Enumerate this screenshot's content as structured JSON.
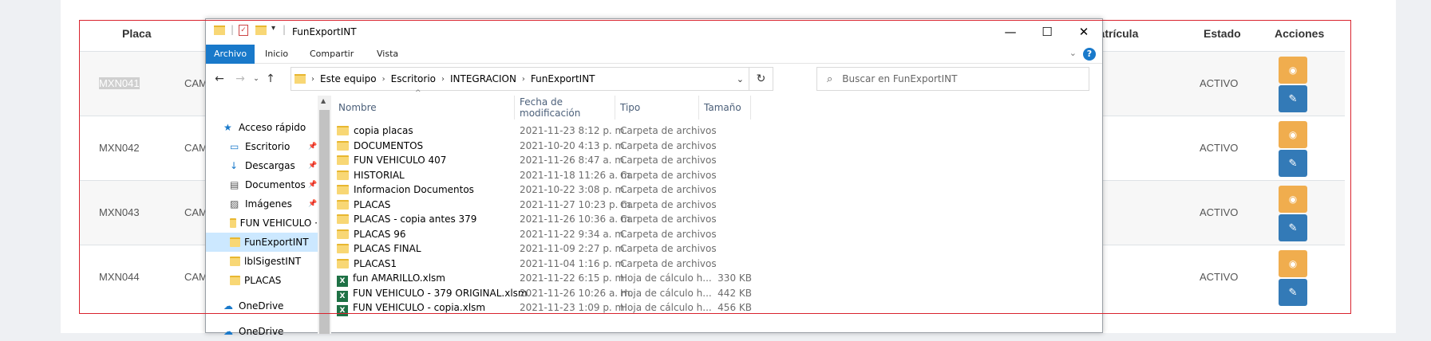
{
  "background_table": {
    "headers": {
      "placa": "Placa",
      "matricula": "natrícula",
      "estado": "Estado",
      "acciones": "Acciones"
    },
    "rows": [
      {
        "placa": "MXN041",
        "tipo": "CAM",
        "estado": "ACTIVO"
      },
      {
        "placa": "MXN042",
        "tipo": "CAM",
        "estado": "ACTIVO"
      },
      {
        "placa": "MXN043",
        "tipo": "CAM",
        "estado": "ACTIVO"
      },
      {
        "placa": "MXN044",
        "tipo": "CAM",
        "estado": "ACTIVO"
      }
    ],
    "colors": {
      "view_button": "#f0ad4e",
      "edit_button": "#337ab7",
      "highlight_box": "#d9232e"
    }
  },
  "explorer": {
    "title": "FunExportINT",
    "ribbon_tabs": [
      "Archivo",
      "Inicio",
      "Compartir",
      "Vista"
    ],
    "breadcrumb": [
      "Este equipo",
      "Escritorio",
      "INTEGRACION",
      "FunExportINT"
    ],
    "search_placeholder": "Buscar en FunExportINT",
    "nav_pane": [
      {
        "label": "Acceso rápido",
        "icon": "star-icon"
      },
      {
        "label": "Escritorio",
        "icon": "desktop-icon",
        "pinned": true
      },
      {
        "label": "Descargas",
        "icon": "download-icon",
        "pinned": true
      },
      {
        "label": "Documentos",
        "icon": "document-icon",
        "pinned": true
      },
      {
        "label": "Imágenes",
        "icon": "image-icon",
        "pinned": true
      },
      {
        "label": "FUN VEHICULO ·",
        "icon": "folder-icon"
      },
      {
        "label": "FunExportINT",
        "icon": "folder-icon",
        "selected": true
      },
      {
        "label": "lblSigestINT",
        "icon": "folder-icon"
      },
      {
        "label": "PLACAS",
        "icon": "folder-icon"
      },
      {
        "label": "OneDrive",
        "icon": "cloud-icon"
      },
      {
        "label": "OneDrive",
        "icon": "cloud-icon"
      }
    ],
    "columns": [
      "Nombre",
      "Fecha de modificación",
      "Tipo",
      "Tamaño"
    ],
    "files": [
      {
        "name": "copia placas",
        "date": "2021-11-23 8:12 p. m.",
        "type": "Carpeta de archivos",
        "size": "",
        "icon": "folder"
      },
      {
        "name": "DOCUMENTOS",
        "date": "2021-10-20 4:13 p. m.",
        "type": "Carpeta de archivos",
        "size": "",
        "icon": "folder"
      },
      {
        "name": "FUN VEHICULO 407",
        "date": "2021-11-26 8:47 a. m.",
        "type": "Carpeta de archivos",
        "size": "",
        "icon": "folder"
      },
      {
        "name": "HISTORIAL",
        "date": "2021-11-18 11:26 a. m.",
        "type": "Carpeta de archivos",
        "size": "",
        "icon": "folder"
      },
      {
        "name": "Informacion Documentos",
        "date": "2021-10-22 3:08 p. m.",
        "type": "Carpeta de archivos",
        "size": "",
        "icon": "folder"
      },
      {
        "name": "PLACAS",
        "date": "2021-11-27 10:23 p. m.",
        "type": "Carpeta de archivos",
        "size": "",
        "icon": "folder"
      },
      {
        "name": "PLACAS - copia antes 379",
        "date": "2021-11-26 10:36 a. m.",
        "type": "Carpeta de archivos",
        "size": "",
        "icon": "folder"
      },
      {
        "name": "PLACAS 96",
        "date": "2021-11-22 9:34 a. m.",
        "type": "Carpeta de archivos",
        "size": "",
        "icon": "folder"
      },
      {
        "name": "PLACAS FINAL",
        "date": "2021-11-09 2:27 p. m.",
        "type": "Carpeta de archivos",
        "size": "",
        "icon": "folder"
      },
      {
        "name": "PLACAS1",
        "date": "2021-11-04 1:16 p. m.",
        "type": "Carpeta de archivos",
        "size": "",
        "icon": "folder"
      },
      {
        "name": "fun AMARILLO.xlsm",
        "date": "2021-11-22 6:15 p. m.",
        "type": "Hoja de cálculo h...",
        "size": "330 KB",
        "icon": "excel"
      },
      {
        "name": "FUN VEHICULO - 379 ORIGINAL.xlsm",
        "date": "2021-11-26 10:26 a. m.",
        "type": "Hoja de cálculo h...",
        "size": "442 KB",
        "icon": "excel"
      },
      {
        "name": "FUN VEHICULO - copia.xlsm",
        "date": "2021-11-23 1:09 p. m.",
        "type": "Hoja de cálculo h...",
        "size": "456 KB",
        "icon": "excel"
      }
    ]
  }
}
